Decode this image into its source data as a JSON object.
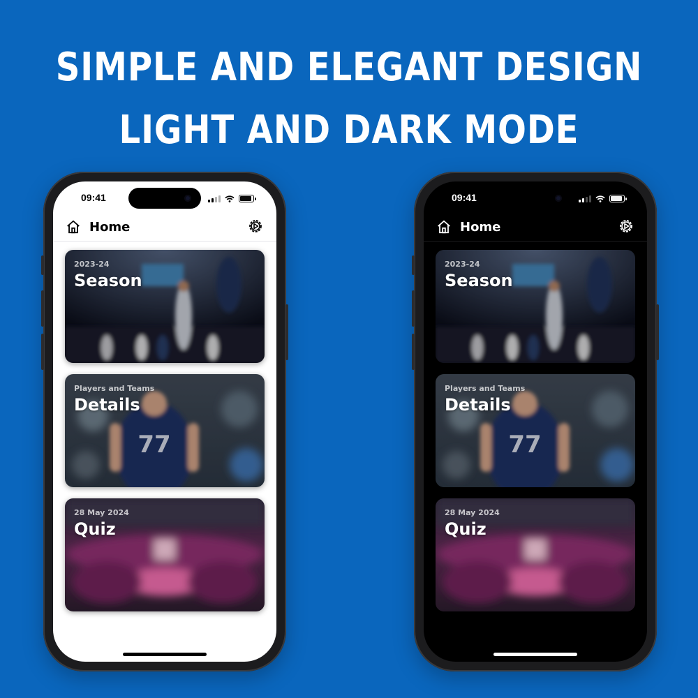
{
  "headline": {
    "line1": "SIMPLE AND ELEGANT DESIGN",
    "line2": "LIGHT AND DARK MODE"
  },
  "colors": {
    "background": "#0a66bd",
    "light_screen": "#ffffff",
    "dark_screen": "#000000"
  },
  "phones": {
    "light": {
      "status": {
        "time": "09:41"
      },
      "nav": {
        "title": "Home",
        "left_icon": "home-icon",
        "right_icon": "gear-icon"
      },
      "cards": [
        {
          "subtitle": "2023-24",
          "title": "Season",
          "image": "basketball-dunk-photo"
        },
        {
          "subtitle": "Players and Teams",
          "title": "Details",
          "image": "player-jersey-77-photo"
        },
        {
          "subtitle": "28 May 2024",
          "title": "Quiz",
          "image": "arena-crowd-photo"
        }
      ]
    },
    "dark": {
      "status": {
        "time": "09:41"
      },
      "nav": {
        "title": "Home",
        "left_icon": "home-icon",
        "right_icon": "gear-icon"
      },
      "cards": [
        {
          "subtitle": "2023-24",
          "title": "Season",
          "image": "basketball-dunk-photo"
        },
        {
          "subtitle": "Players and Teams",
          "title": "Details",
          "image": "player-jersey-77-photo"
        },
        {
          "subtitle": "28 May 2024",
          "title": "Quiz",
          "image": "arena-crowd-photo"
        }
      ]
    }
  }
}
